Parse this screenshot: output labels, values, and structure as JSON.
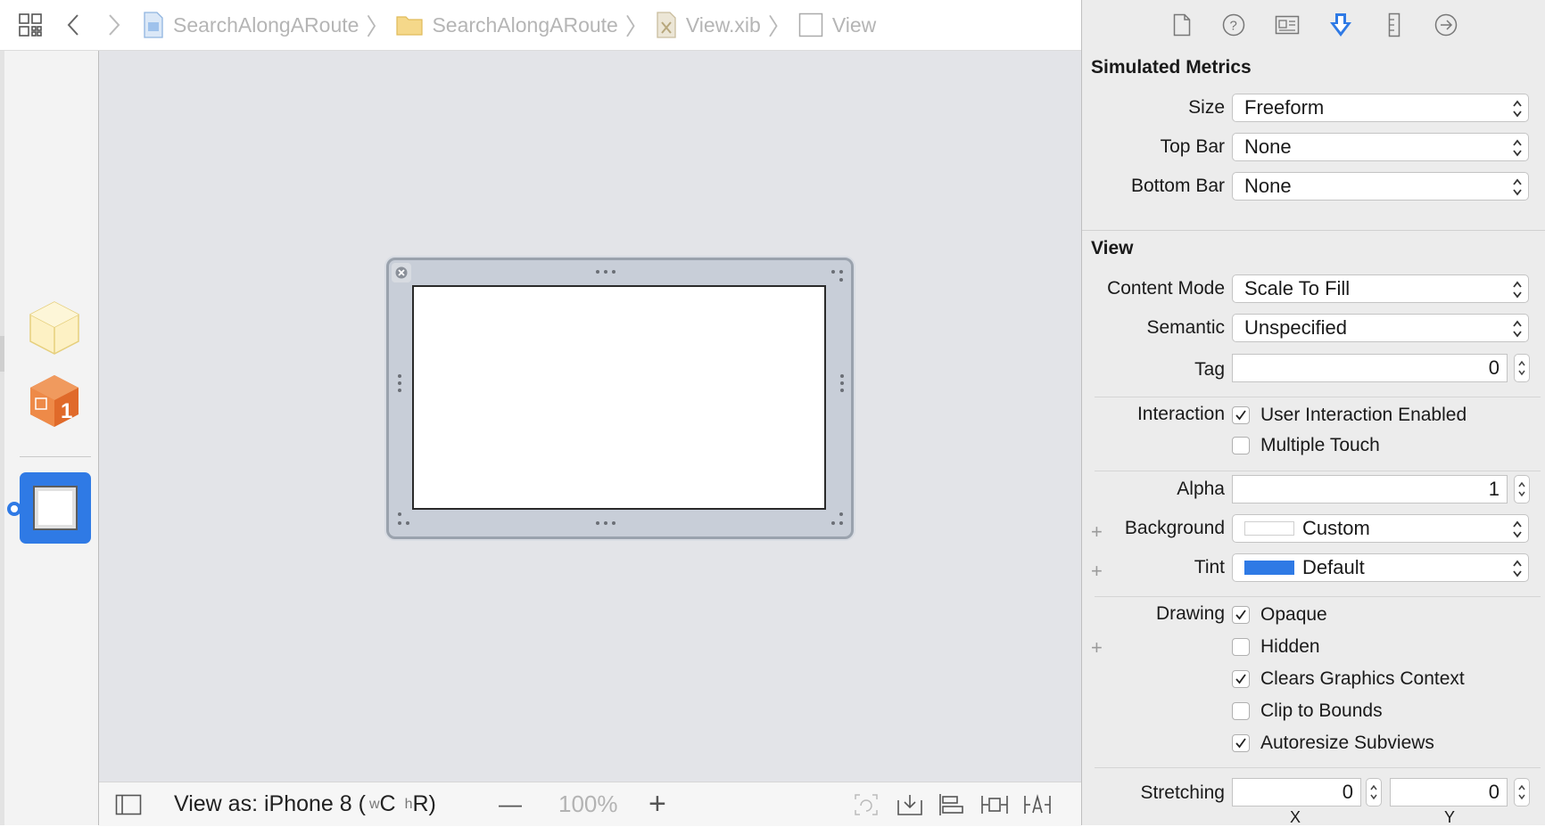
{
  "breadcrumb": [
    {
      "label": "SearchAlongARoute",
      "icon": "project-icon"
    },
    {
      "label": "SearchAlongARoute",
      "icon": "folder-icon"
    },
    {
      "label": "View.xib",
      "icon": "xib-file-icon"
    },
    {
      "label": "View",
      "icon": "view-icon"
    }
  ],
  "bottom_bar": {
    "view_as_label": "View as: iPhone 8 (",
    "size_class_w": "w",
    "size_class_w_value": "C",
    "size_class_h": "h",
    "size_class_h_value": "R)",
    "zoom_out": "—",
    "zoom_value": "100%",
    "zoom_in": "+"
  },
  "inspector": {
    "tabs": [
      "file-inspector-icon",
      "quick-help-icon",
      "identity-inspector-icon",
      "attributes-inspector-icon",
      "size-inspector-icon",
      "connections-inspector-icon"
    ],
    "simulated_metrics": {
      "title": "Simulated Metrics",
      "size_label": "Size",
      "size_value": "Freeform",
      "top_bar_label": "Top Bar",
      "top_bar_value": "None",
      "bottom_bar_label": "Bottom Bar",
      "bottom_bar_value": "None"
    },
    "view": {
      "title": "View",
      "content_mode_label": "Content Mode",
      "content_mode_value": "Scale To Fill",
      "semantic_label": "Semantic",
      "semantic_value": "Unspecified",
      "tag_label": "Tag",
      "tag_value": "0",
      "interaction_label": "Interaction",
      "user_interaction_label": "User Interaction Enabled",
      "user_interaction_checked": true,
      "multiple_touch_label": "Multiple Touch",
      "multiple_touch_checked": false,
      "alpha_label": "Alpha",
      "alpha_value": "1",
      "background_label": "Background",
      "background_value": "Custom",
      "background_color": "#ffffff",
      "tint_label": "Tint",
      "tint_value": "Default",
      "tint_color": "#2f7ae5",
      "drawing_label": "Drawing",
      "opaque_label": "Opaque",
      "opaque_checked": true,
      "hidden_label": "Hidden",
      "hidden_checked": false,
      "clears_label": "Clears Graphics Context",
      "clears_checked": true,
      "clip_label": "Clip to Bounds",
      "clip_checked": false,
      "autoresize_label": "Autoresize Subviews",
      "autoresize_checked": true,
      "stretching_label": "Stretching",
      "stretching_x_value": "0",
      "stretching_y_value": "0",
      "stretching_x_label": "X",
      "stretching_y_label": "Y"
    }
  },
  "colors": {
    "accent": "#2f7ae5",
    "canvas": "#e3e4e8"
  }
}
